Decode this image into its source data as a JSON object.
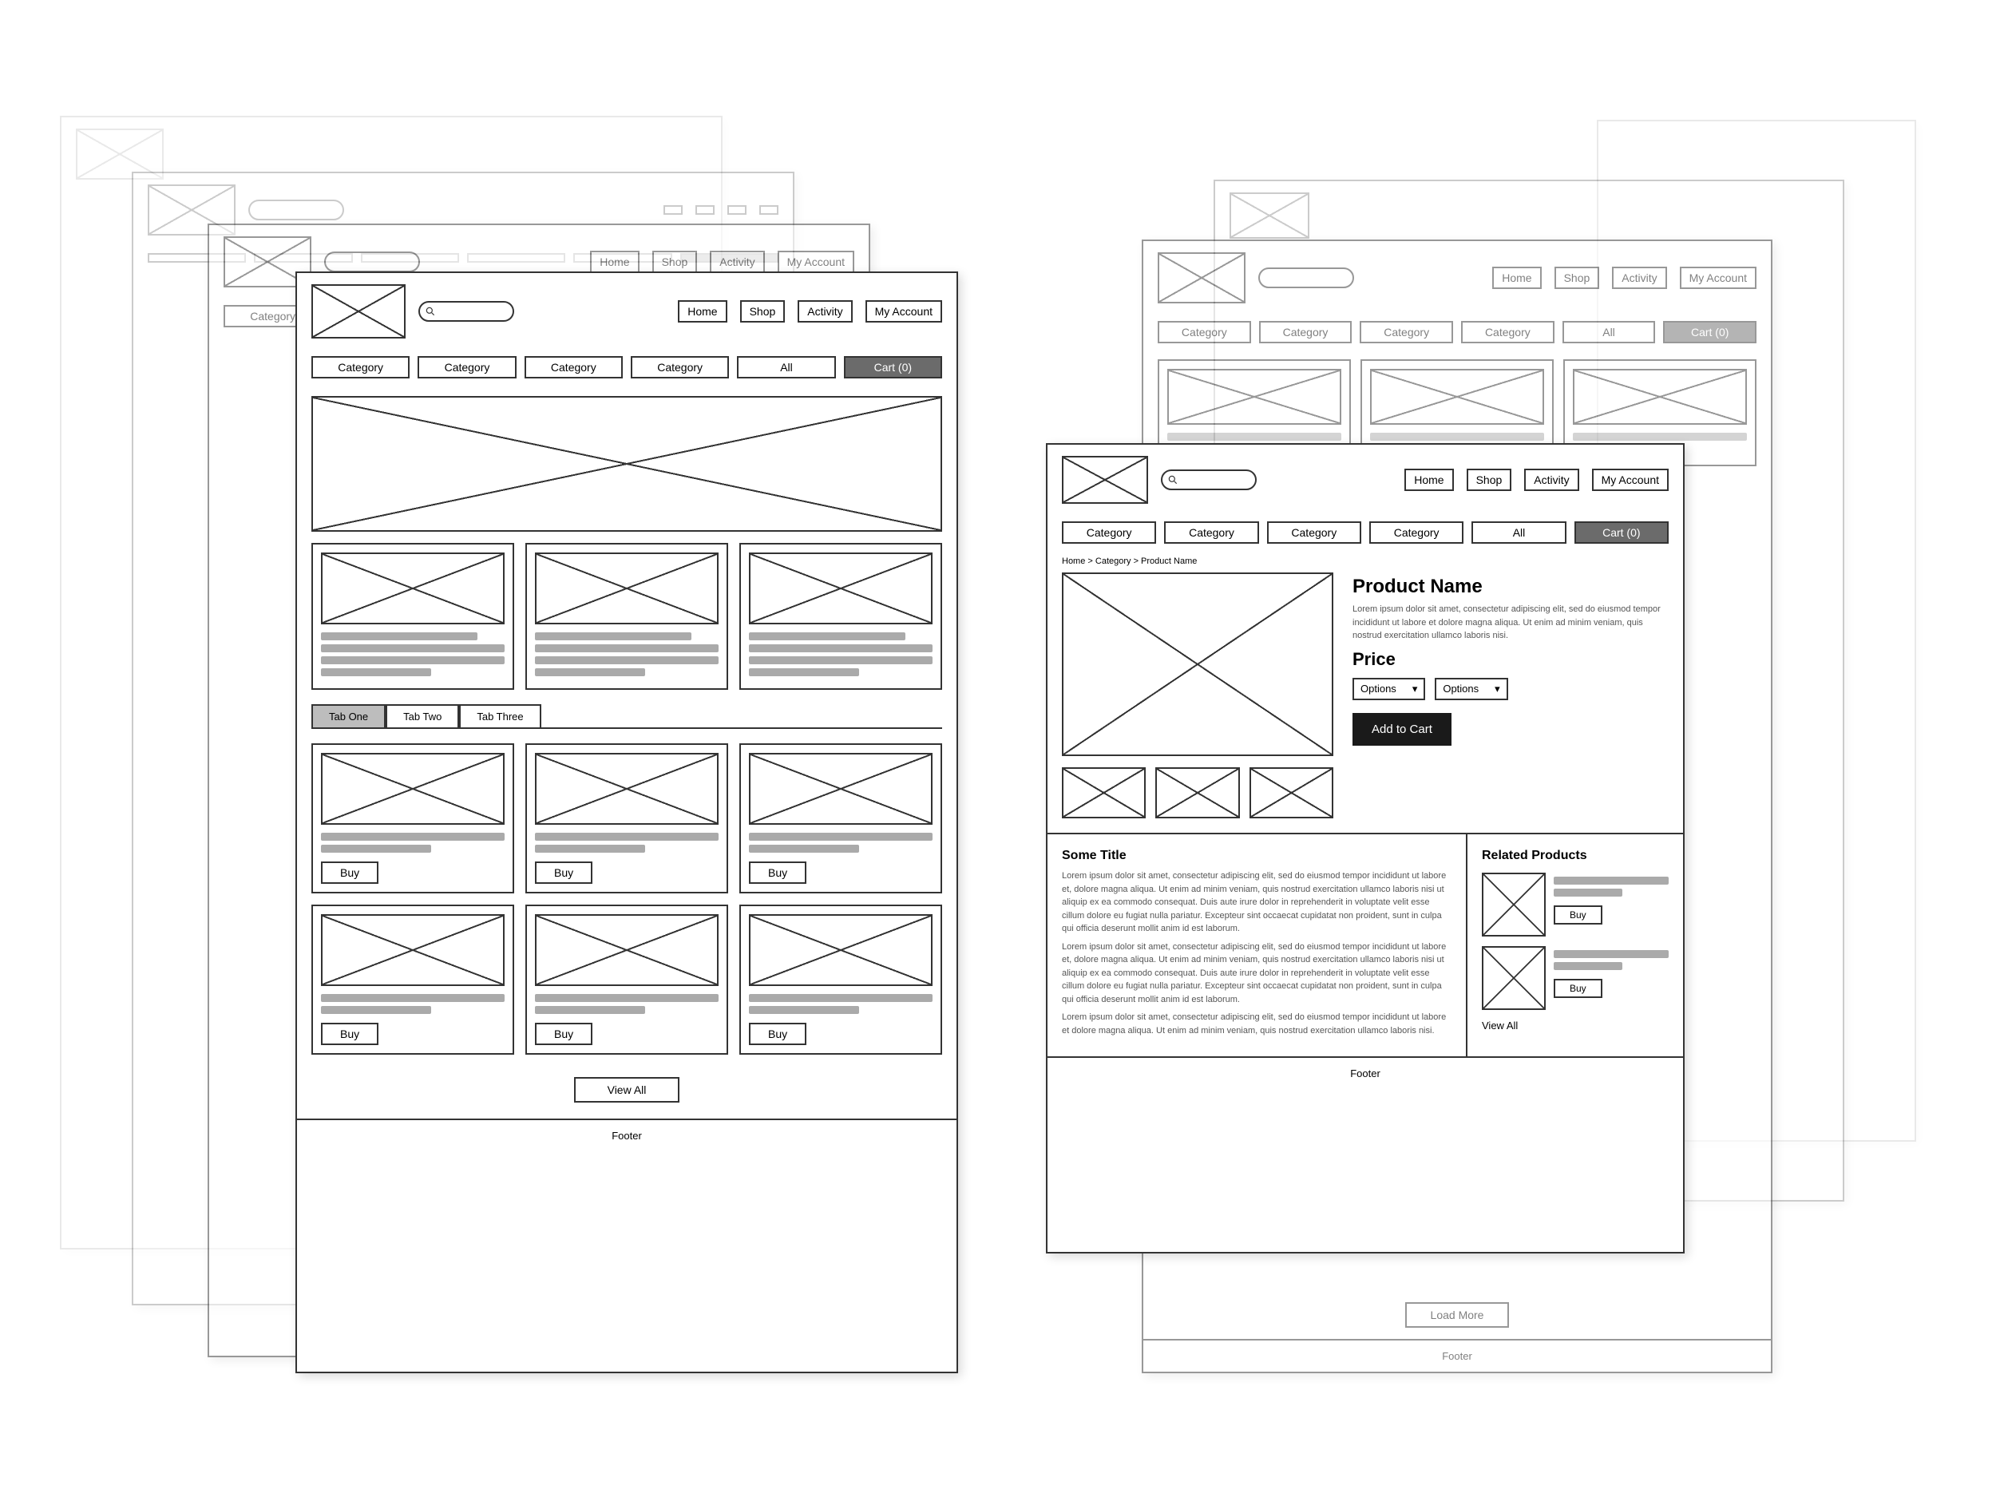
{
  "nav": {
    "home": "Home",
    "shop": "Shop",
    "activity": "Activity",
    "account": "My Account"
  },
  "categories": {
    "cat": "Category",
    "all": "All",
    "cart": "Cart (0)"
  },
  "home_frame": {
    "tabs": {
      "one": "Tab One",
      "two": "Tab Two",
      "three": "Tab Three"
    },
    "buy": "Buy",
    "view_all": "View All",
    "footer": "Footer"
  },
  "product_frame": {
    "breadcrumb": "Home > Category > Product Name",
    "title": "Product Name",
    "lorem_short": "Lorem ipsum dolor sit amet, consectetur adipiscing elit, sed do eiusmod tempor incididunt ut labore et dolore magna aliqua. Ut enim ad minim veniam, quis nostrud exercitation ullamco laboris nisi.",
    "price_label": "Price",
    "option": "Options",
    "add_cart": "Add to Cart",
    "some_title": "Some Title",
    "lorem_para": "Lorem ipsum dolor sit amet, consectetur adipiscing elit, sed do eiusmod tempor incididunt ut labore et, dolore magna aliqua. Ut enim ad minim veniam, quis nostrud exercitation ullamco laboris nisi ut aliquip ex ea commodo consequat. Duis aute irure dolor in reprehenderit in voluptate velit esse cillum dolore eu fugiat nulla pariatur. Excepteur sint occaecat cupidatat non proident, sunt in culpa qui officia deserunt mollit anim id est laborum.",
    "related": "Related Products",
    "buy": "Buy",
    "view_all": "View All",
    "footer": "Footer",
    "load_more": "Load More"
  }
}
